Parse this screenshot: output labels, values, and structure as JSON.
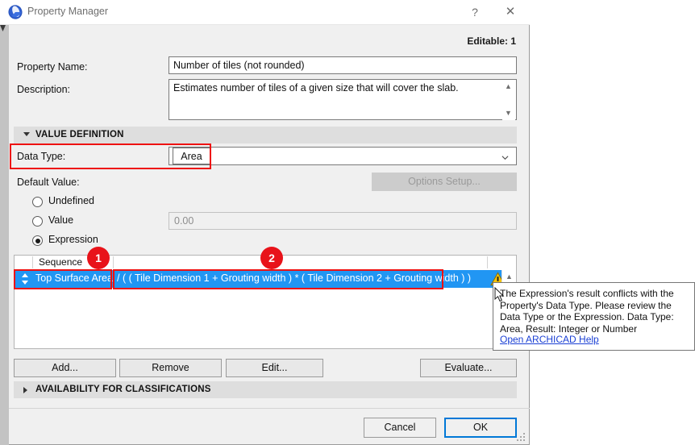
{
  "window": {
    "title": "Property Manager",
    "icon": "archicad-app-icon",
    "help_label": "?",
    "close_label": "✕"
  },
  "header": {
    "editable_label": "Editable: 1"
  },
  "form": {
    "property_name_label": "Property Name:",
    "property_name_value": "Number of tiles (not rounded)",
    "description_label": "Description:",
    "description_value": "Estimates number of tiles of a given size that will cover the slab."
  },
  "value_definition": {
    "section_label": "VALUE DEFINITION",
    "expanded": true,
    "data_type_label": "Data Type:",
    "data_type_value": "Area",
    "default_value_label": "Default Value:",
    "options_setup_label": "Options Setup...",
    "options_setup_enabled": false,
    "radios": [
      {
        "id": "undefined",
        "label": "Undefined",
        "checked": false
      },
      {
        "id": "value",
        "label": "Value",
        "checked": false
      },
      {
        "id": "expression",
        "label": "Expression",
        "checked": true
      }
    ],
    "value_field_text": "0.00"
  },
  "expression_list": {
    "column_header": "Sequence",
    "rows": [
      {
        "sequence": "Top Surface Area",
        "expression": "/ ( ( Tile Dimension 1 + Grouting width ) * ( Tile Dimension 2 + Grouting width ) )",
        "selected": true,
        "has_warning": true
      }
    ]
  },
  "actions": {
    "add_label": "Add...",
    "remove_label": "Remove",
    "edit_label": "Edit...",
    "evaluate_label": "Evaluate..."
  },
  "availability": {
    "section_label": "AVAILABILITY FOR CLASSIFICATIONS",
    "expanded": false
  },
  "footer": {
    "cancel_label": "Cancel",
    "ok_label": "OK"
  },
  "tooltip": {
    "message": "The Expression's result conflicts with the Property's Data Type. Please review the Data Type or the Expression. Data Type: Area, Result: Integer or Number",
    "link_label": "Open ARCHICAD Help"
  },
  "annotations": {
    "badge_1": "1",
    "badge_2": "2",
    "highlight_color": "#ee1111",
    "badge_color": "#e8131a"
  },
  "colors": {
    "selection_blue": "#2196f3",
    "focus_blue": "#0078d7",
    "section_gray": "#dedede",
    "dialog_bg": "#f0f0f0",
    "link_blue": "#1a3fd4"
  }
}
